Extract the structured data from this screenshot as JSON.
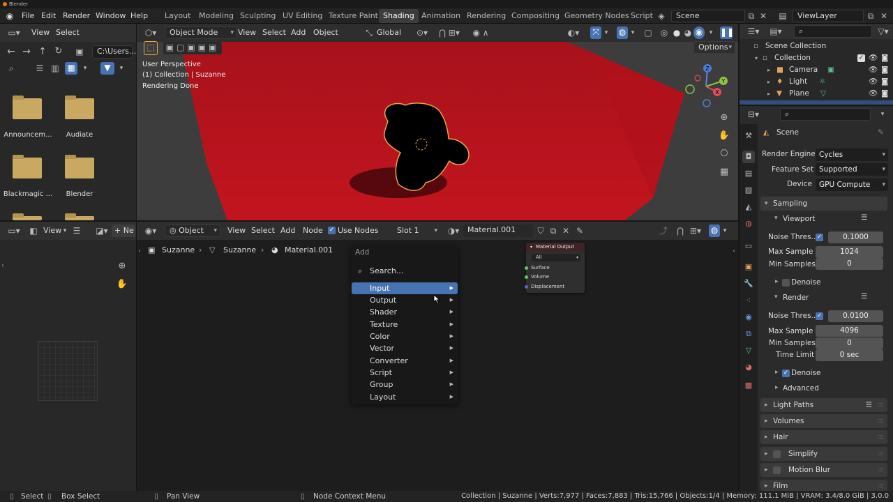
{
  "window": {
    "title": "Blender"
  },
  "menus": [
    "File",
    "Edit",
    "Render",
    "Window",
    "Help"
  ],
  "workspaces": [
    "Layout",
    "Modeling",
    "Sculpting",
    "UV Editing",
    "Texture Paint",
    "Shading",
    "Animation",
    "Rendering",
    "Compositing",
    "Geometry Nodes",
    "Script"
  ],
  "active_workspace": "Shading",
  "scene": {
    "name": "Scene"
  },
  "viewlayer": {
    "name": "ViewLayer"
  },
  "filebrowser": {
    "header": [
      "View",
      "Select"
    ],
    "path": "C:\\Users...",
    "folders": [
      "Announcem...",
      "Audiate",
      "Blackmagic ...",
      "Blender"
    ]
  },
  "viewport": {
    "mode": "Object Mode",
    "menus": [
      "View",
      "Select",
      "Add",
      "Object"
    ],
    "transform": "Global",
    "options": "Options",
    "overlay": [
      "User Perspective",
      "(1) Collection | Suzanne",
      "Rendering Done"
    ],
    "gizmo": {
      "z": "Z",
      "y": "Y",
      "x": "X"
    }
  },
  "outliner": {
    "root": "Scene Collection",
    "collection": "Collection",
    "items": [
      "Camera",
      "Light",
      "Plane"
    ]
  },
  "properties": {
    "context": "Scene",
    "render_engine_label": "Render Engine",
    "render_engine": "Cycles",
    "feature_set_label": "Feature Set",
    "feature_set": "Supported",
    "device_label": "Device",
    "device": "GPU Compute",
    "sampling": "Sampling",
    "viewport": {
      "title": "Viewport",
      "noise_label": "Noise Thres...",
      "noise": "0.1000",
      "max_label": "Max Sample",
      "max": "1024",
      "min_label": "Min Samples",
      "min": "0",
      "denoise": "Denoise"
    },
    "render": {
      "title": "Render",
      "noise_label": "Noise Thres...",
      "noise": "0.0100",
      "max_label": "Max Sample",
      "max": "4096",
      "min_label": "Min Samples",
      "min": "0",
      "time_label": "Time Limit",
      "time": "0 sec",
      "denoise": "Denoise",
      "advanced": "Advanced"
    },
    "panels": [
      "Light Paths",
      "Volumes",
      "Hair",
      "Simplify",
      "Motion Blur",
      "Film"
    ]
  },
  "node_editor": {
    "left_header": {
      "view": "View",
      "new": "Ne"
    },
    "type": "Object",
    "menus": [
      "View",
      "Select",
      "Add",
      "Node"
    ],
    "use_nodes": "Use Nodes",
    "slot": "Slot 1",
    "material": "Material.001",
    "breadcrumb": [
      "Suzanne",
      "Suzanne",
      "Material.001"
    ],
    "add_menu": {
      "title": "Add",
      "search": "Search...",
      "items": [
        "Input",
        "Output",
        "Shader",
        "Texture",
        "Color",
        "Vector",
        "Converter",
        "Script",
        "Group",
        "Layout"
      ],
      "highlighted": "Input"
    },
    "material_output": {
      "title": "Material Output",
      "target": "All",
      "sockets": [
        "Surface",
        "Volume",
        "Displacement"
      ]
    }
  },
  "statusbar": {
    "select": "Select",
    "box_select": "Box Select",
    "pan": "Pan View",
    "context": "Node Context Menu",
    "stats": "Collection | Suzanne | Verts:7,977 | Faces:7,883 | Tris:15,766 | Objects:1/4 | Memory: 111.1 MiB | VRAM: 3.4/8.0 GiB | 3.0.0"
  }
}
